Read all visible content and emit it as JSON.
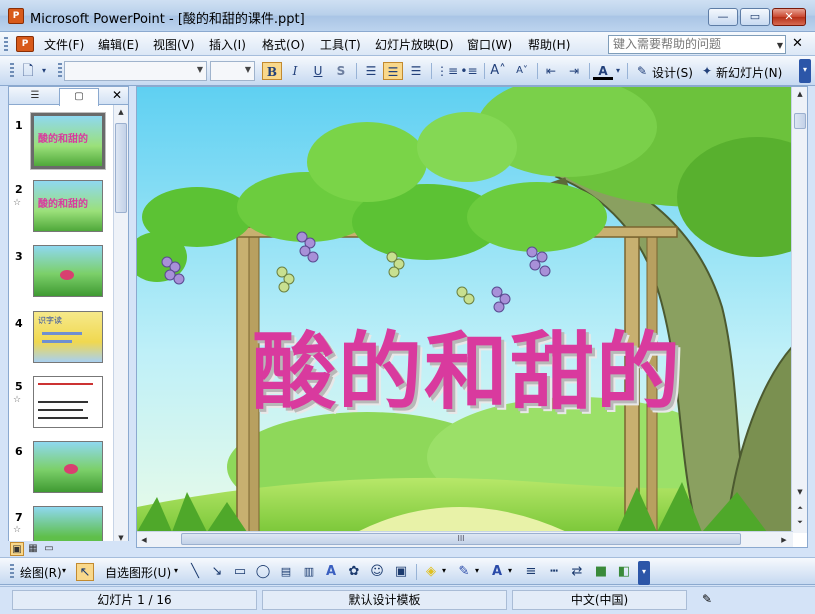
{
  "window": {
    "app_icon": "P",
    "title": "Microsoft PowerPoint - [酸的和甜的课件.ppt]",
    "min_label": "—",
    "max_label": "▭",
    "close_label": "✕"
  },
  "menubar": {
    "items": [
      "文件(F)",
      "编辑(E)",
      "视图(V)",
      "插入(I)",
      "格式(O)",
      "工具(T)",
      "幻灯片放映(D)",
      "窗口(W)",
      "帮助(H)"
    ],
    "help_placeholder": "键入需要帮助的问题",
    "doc_close": "✕"
  },
  "toolbar": {
    "font_name": "",
    "font_size": "",
    "bold": "B",
    "italic": "I",
    "underline": "U",
    "shadow": "S",
    "design_label": "设计(S)",
    "new_slide_label": "新幻灯片(N)",
    "font_color_label": "A"
  },
  "left_panel": {
    "tab_outline": "☰",
    "tab_slides": "▢",
    "close": "✕",
    "slides": [
      {
        "num": "1",
        "star": false,
        "title": "酸的和甜的",
        "selected": true
      },
      {
        "num": "2",
        "star": true,
        "title": "酸的和甜的",
        "selected": false
      },
      {
        "num": "3",
        "star": false,
        "title": "",
        "selected": false
      },
      {
        "num": "4",
        "star": false,
        "title": "识字读",
        "selected": false
      },
      {
        "num": "5",
        "star": true,
        "title": "",
        "selected": false
      },
      {
        "num": "6",
        "star": false,
        "title": "",
        "selected": false
      },
      {
        "num": "7",
        "star": true,
        "title": "",
        "selected": false
      }
    ]
  },
  "slide": {
    "title": "酸的和甜的",
    "title_color": "#d93a9e"
  },
  "drawbar": {
    "draw_label": "绘图(R)",
    "autoshapes_label": "自选图形(U)"
  },
  "statusbar": {
    "slide_info": "幻灯片 1 / 16",
    "template": "默认设计模板",
    "language": "中文(中国)"
  }
}
